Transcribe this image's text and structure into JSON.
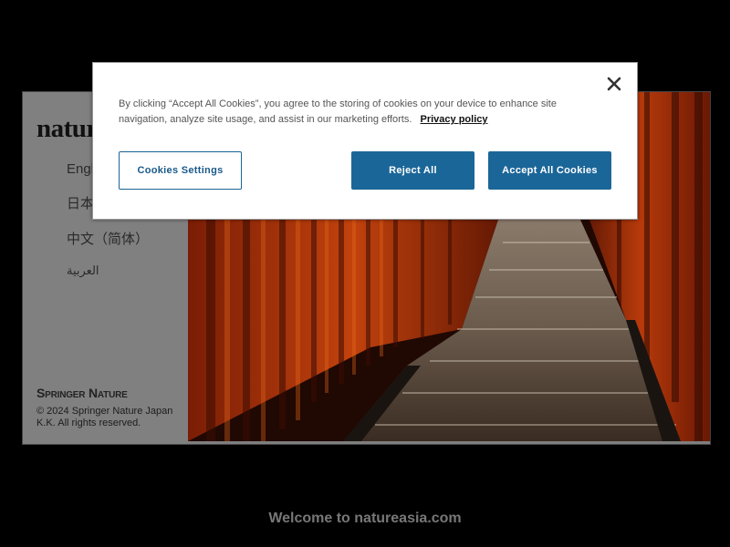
{
  "sidebar": {
    "logo": "nature",
    "languages": [
      "English",
      "日本語",
      "中文（简体）",
      "العربية"
    ],
    "publisher": "Springer Nature",
    "copyright": "© 2024 Springer Nature Japan K.K. All rights reserved."
  },
  "footer": {
    "welcome": "Welcome to natureasia.com"
  },
  "cookie_banner": {
    "message": "By clicking “Accept All Cookies”, you agree to the storing of cookies on your device to enhance site navigation, analyze site usage, and assist in our marketing efforts.",
    "privacy_link": "Privacy policy",
    "settings_label": "Cookies Settings",
    "reject_label": "Reject All",
    "accept_label": "Accept All Cookies",
    "close_icon": "close-icon"
  },
  "colors": {
    "button_blue": "#1b6698",
    "background": "#000000",
    "sidebar": "#808080"
  }
}
